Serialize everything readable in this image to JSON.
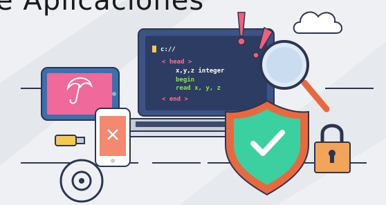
{
  "title": "e Aplicaciones",
  "code": {
    "path": "c://",
    "lines": [
      {
        "text": "< head >",
        "color": "#ff6f8a"
      },
      {
        "text": "x,y,z integer",
        "color": "#ffffff"
      },
      {
        "text": "begin",
        "color": "#8ee44a"
      },
      {
        "text": "read x, y, z",
        "color": "#8ee44a"
      },
      {
        "text": "< end >",
        "color": "#ff6f8a"
      }
    ]
  },
  "colors": {
    "background": "#eef0f4",
    "laptop_screen": "#2d3c63",
    "laptop_frame": "#3d5285",
    "shield": "#3ccf9f",
    "shield_border": "#e8683f",
    "accent_pink": "#f0607a",
    "lock": "#f2a45a",
    "tablet": "#3c6fb0"
  },
  "icons": [
    "cloud-icon",
    "laptop-icon",
    "tablet-icon",
    "umbrella-icon",
    "phone-icon",
    "usb-drive-icon",
    "cd-disc-icon",
    "magnifier-icon",
    "shield-check-icon",
    "padlock-icon",
    "exclamation-icon"
  ]
}
